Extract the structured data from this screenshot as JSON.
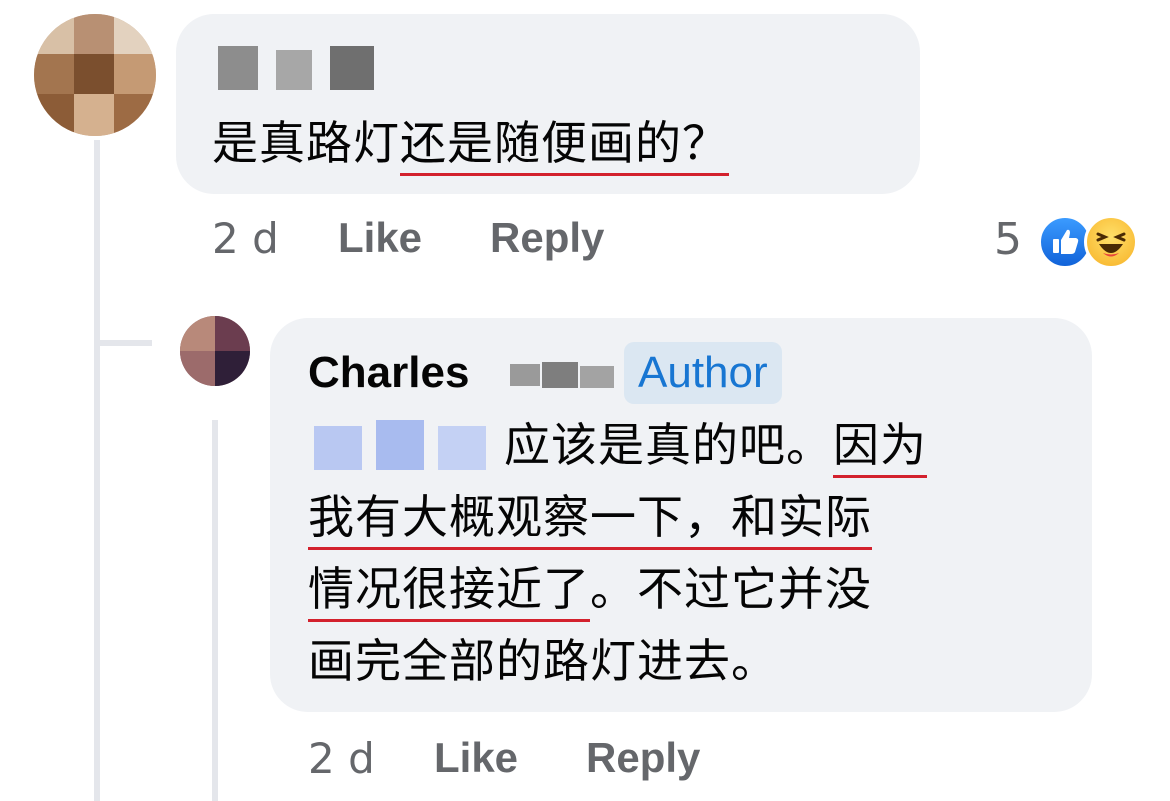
{
  "comment": {
    "text_plain": "是真路灯",
    "text_underlined": "还是随便画的？",
    "time": "2 d",
    "like_label": "Like",
    "reply_label": "Reply",
    "reaction_count": "5",
    "reactions": [
      "like-icon",
      "haha-icon"
    ]
  },
  "reply": {
    "author_name": "Charles",
    "author_badge": "Author",
    "line1_plain": "应该是真的吧。",
    "line1_underlined": "因为",
    "line2_underlined": "我有大概观察一下，和实际",
    "line3_underlined": "情况很接近了",
    "line3_plain": "。不过它并没",
    "line4_plain": "画完全部的路灯进去。",
    "time": "2 d",
    "like_label": "Like",
    "reply_label": "Reply"
  },
  "colors": {
    "bubble_bg": "#f0f2f5",
    "meta_text": "#65676b",
    "author_badge_bg": "#dbe7f2",
    "author_badge_text": "#1876d2",
    "underline": "#d3212d"
  }
}
